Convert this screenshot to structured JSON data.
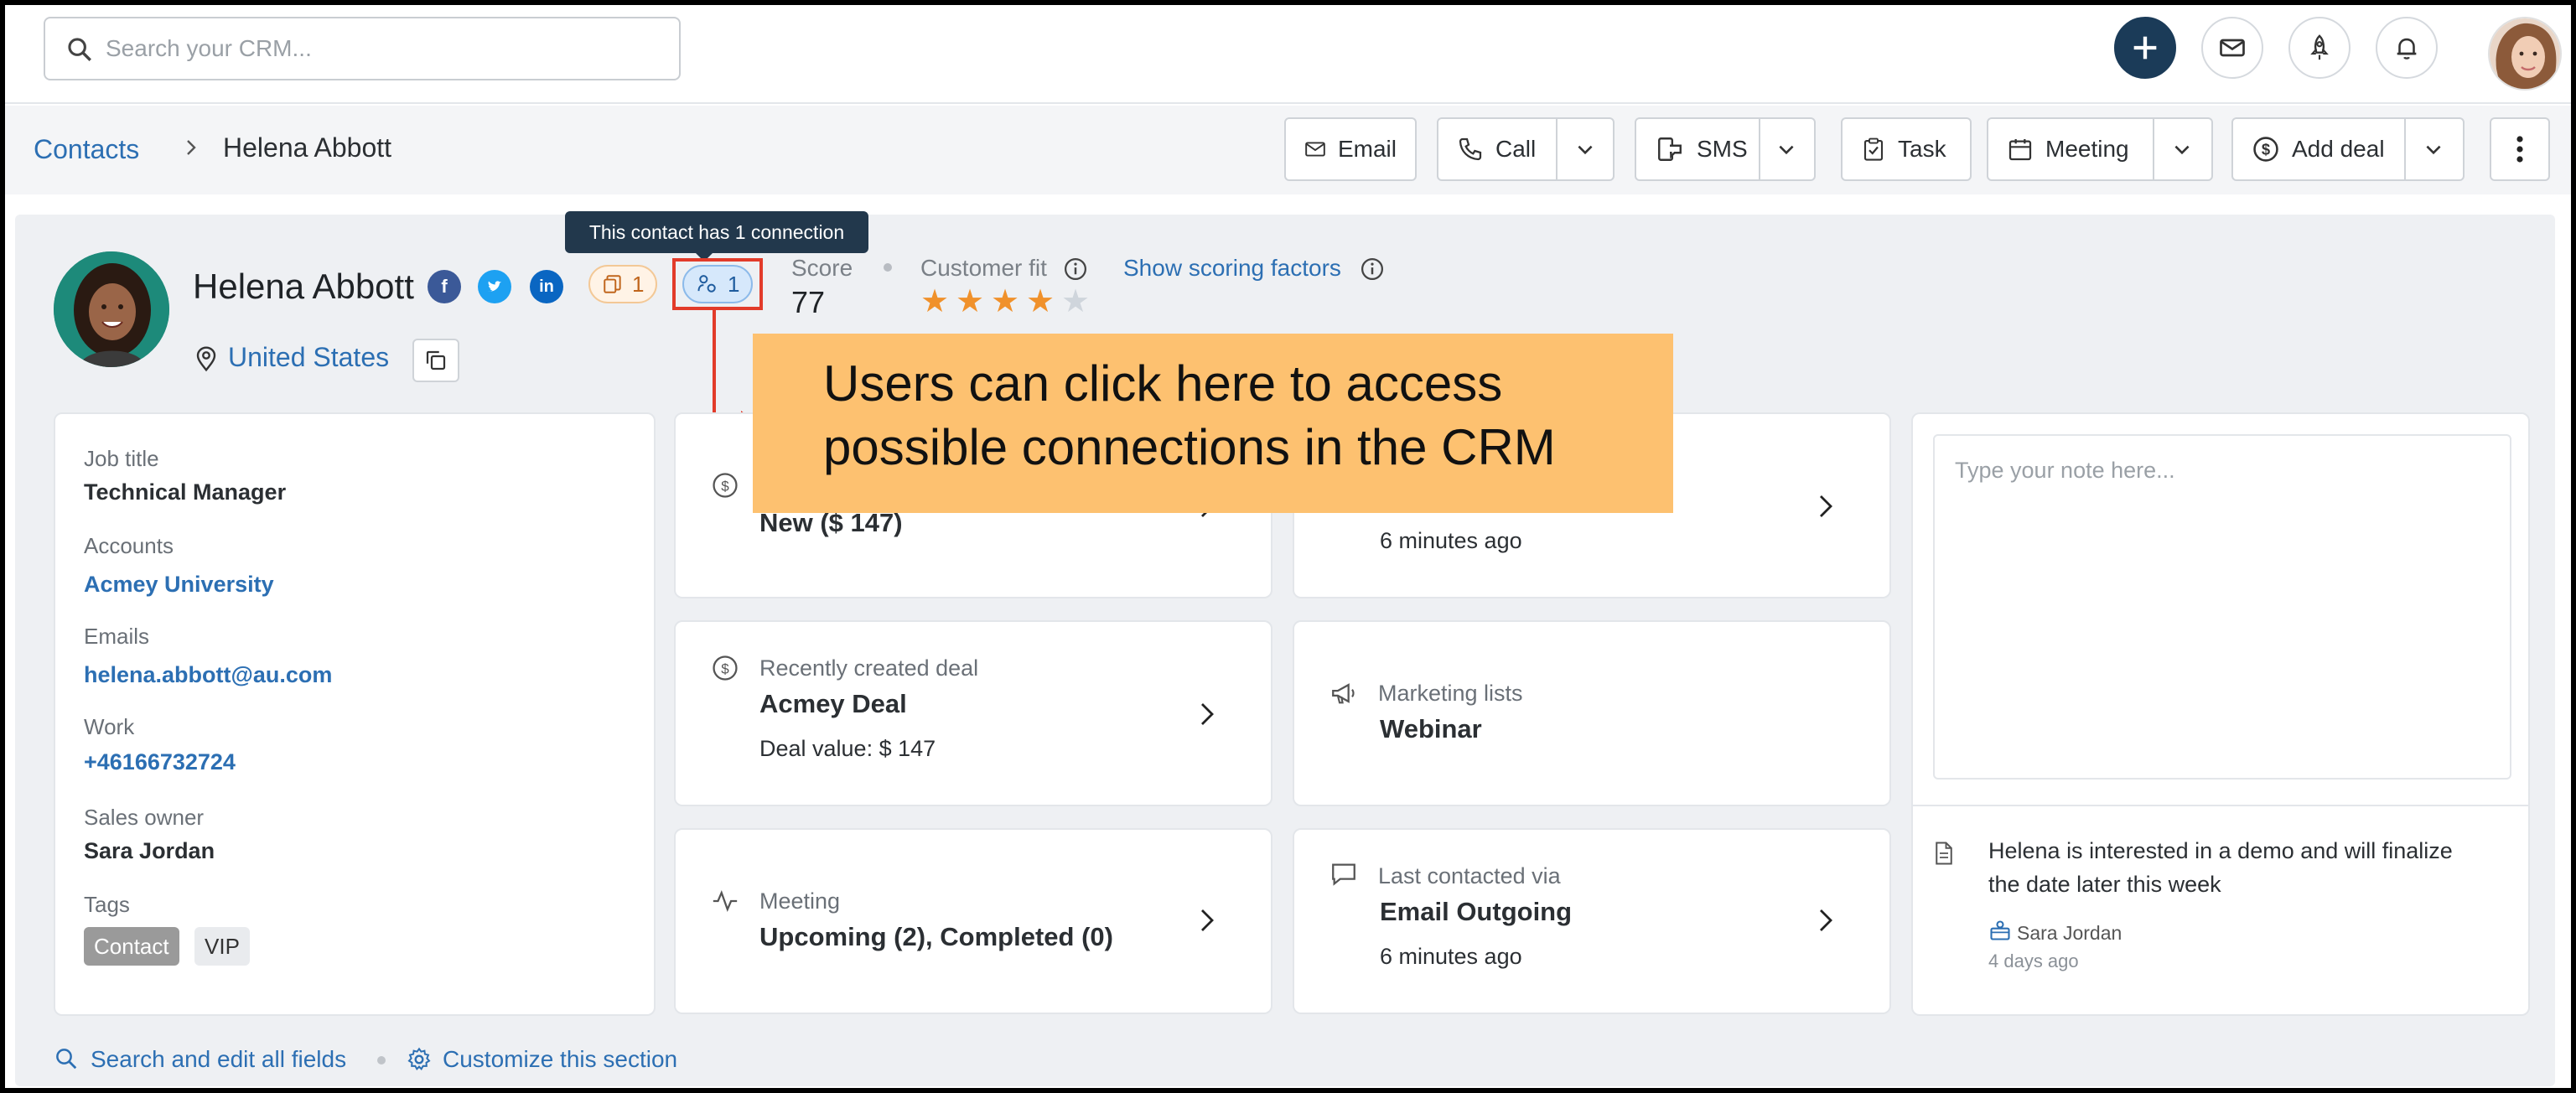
{
  "topbar": {
    "search_placeholder": "Search your CRM...",
    "icons": [
      "plus-icon",
      "mail-icon",
      "rocket-icon",
      "bell-icon"
    ]
  },
  "breadcrumb": {
    "root": "Contacts",
    "current": "Helena Abbott"
  },
  "toolbar": {
    "email": "Email",
    "call": "Call",
    "sms": "SMS",
    "task": "Task",
    "meeting": "Meeting",
    "add_deal": "Add deal"
  },
  "contact": {
    "name": "Helena Abbott",
    "location": "United States",
    "accounts_count": "1",
    "connections_count": "1",
    "connection_tooltip": "This contact has 1 connection",
    "score_label": "Score",
    "score": "77",
    "fit_label": "Customer fit",
    "fit_rating": 4,
    "fit_max": 5,
    "scoring_link": "Show scoring factors"
  },
  "callout": {
    "line1": "Users can click here to access",
    "line2": "possible connections in the CRM"
  },
  "details": {
    "job_title_label": "Job title",
    "job_title": "Technical Manager",
    "accounts_label": "Accounts",
    "account": "Acmey University",
    "emails_label": "Emails",
    "email": "helena.abbott@au.com",
    "work_label": "Work",
    "phone": "+46166732724",
    "owner_label": "Sales owner",
    "owner": "Sara Jordan",
    "tags_label": "Tags",
    "tags": [
      "Contact",
      "VIP"
    ]
  },
  "cards": {
    "deal_status": "New ($ 147)",
    "activity_time": "6 minutes ago",
    "recent_deal_label": "Recently created deal",
    "recent_deal_name": "Acmey Deal",
    "recent_deal_value": "Deal value: $ 147",
    "marketing_label": "Marketing lists",
    "marketing_value": "Webinar",
    "meeting_label": "Meeting",
    "meeting_value": "Upcoming (2), Completed (0)",
    "last_contact_label": "Last contacted via",
    "last_contact_value": "Email Outgoing",
    "last_contact_time": "6 minutes ago"
  },
  "notes": {
    "placeholder": "Type your note here...",
    "note_line1": "Helena is interested in a demo and will finalize",
    "note_line2": "the date later this week",
    "author": "Sara Jordan",
    "time": "4 days ago"
  },
  "footer": {
    "search_fields": "Search and edit all fields",
    "customize": "Customize this section"
  },
  "colors": {
    "link": "#2c6fb3",
    "primary": "#1b3b58",
    "callout": "#fdc170",
    "annotation": "#e23b2a",
    "star": "#f0912b"
  }
}
